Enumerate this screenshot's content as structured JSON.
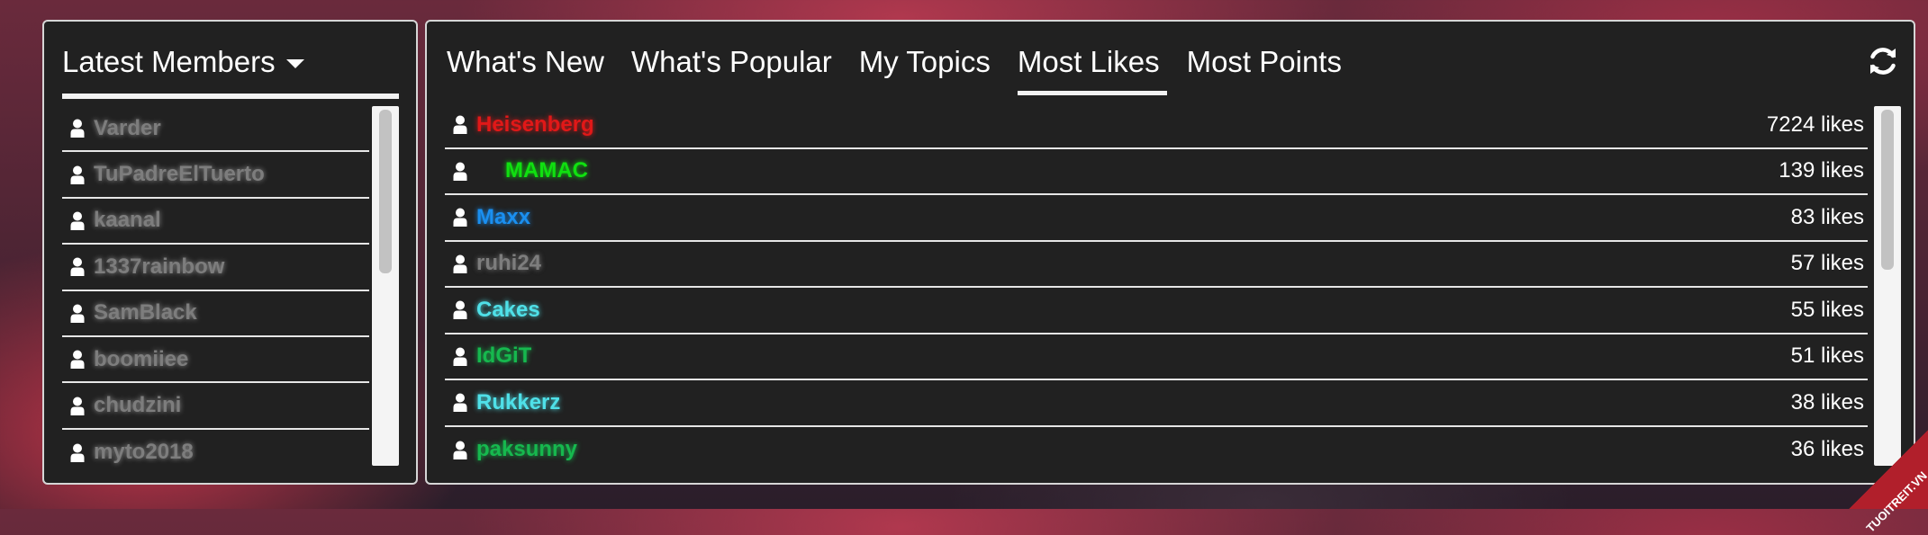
{
  "members": {
    "title": "Latest Members",
    "items": [
      {
        "name": "Varder"
      },
      {
        "name": "TuPadreElTuerto"
      },
      {
        "name": "kaanal"
      },
      {
        "name": "1337rainbow"
      },
      {
        "name": "SamBlack"
      },
      {
        "name": "boomiiee"
      },
      {
        "name": "chudzini"
      },
      {
        "name": "myto2018"
      }
    ],
    "name_color": "#7d7d7d"
  },
  "tabs": [
    {
      "label": "What's New"
    },
    {
      "label": "What's Popular"
    },
    {
      "label": "My Topics"
    },
    {
      "label": "Most Likes",
      "active": true
    },
    {
      "label": "Most Points"
    }
  ],
  "likes": {
    "rows": [
      {
        "name": "Heisenberg",
        "count": "7224 likes",
        "color": "#e01818"
      },
      {
        "name": "MAMAC",
        "count": "139 likes",
        "color": "#10e010",
        "indent": true
      },
      {
        "name": "Maxx",
        "count": "83 likes",
        "color": "#1a8ff0"
      },
      {
        "name": "ruhi24",
        "count": "57 likes",
        "color": "#7d7d7d"
      },
      {
        "name": "Cakes",
        "count": "55 likes",
        "color": "#4fe0e8"
      },
      {
        "name": "IdGiT",
        "count": "51 likes",
        "color": "#16b84e"
      },
      {
        "name": "Rukkerz",
        "count": "38 likes",
        "color": "#4fe0e8"
      },
      {
        "name": "paksunny",
        "count": "36 likes",
        "color": "#16b84e"
      }
    ]
  },
  "icons": {
    "user": "user-icon",
    "refresh": "refresh-icon",
    "dropdown": "caret-down-icon"
  },
  "watermark": "TUOITREIT.VN"
}
